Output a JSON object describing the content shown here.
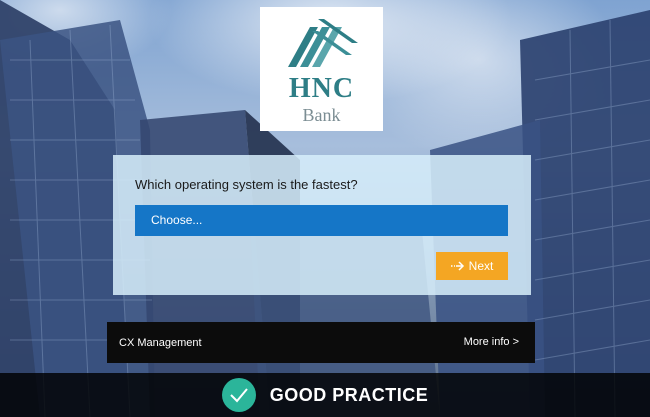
{
  "brand": {
    "name": "HNC",
    "subtitle": "Bank",
    "primary_color": "#2e7e86",
    "logo_icon": "hnc-logo-mark"
  },
  "form": {
    "question": "Which operating system is the fastest?",
    "select_value": "Choose...",
    "next_label": "Next",
    "next_icon": "arrow-right-icon",
    "select_color": "#1576c7",
    "next_color": "#f4a623"
  },
  "cx_bar": {
    "left_label": "CX Management",
    "right_label": "More info >"
  },
  "footer": {
    "label": "GOOD PRACTICE",
    "icon": "check-icon",
    "icon_color": "#2bb59a"
  }
}
